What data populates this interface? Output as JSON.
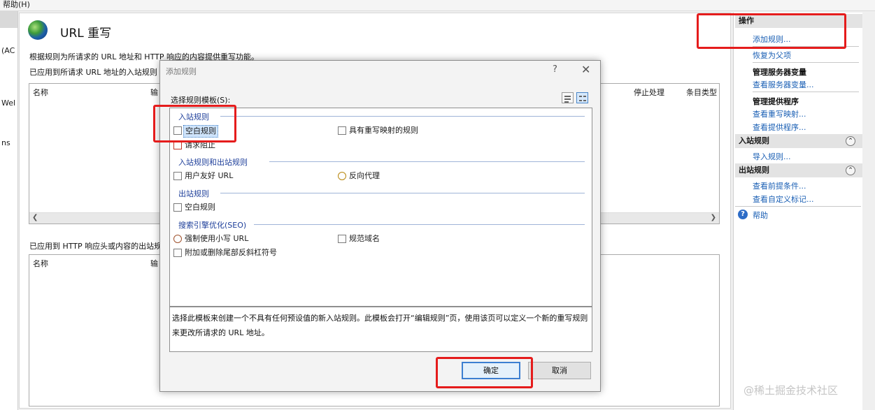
{
  "menubar": {
    "help": "帮助(H)"
  },
  "lefttree": {
    "fragments": [
      "(AC",
      "Wel",
      "ns"
    ]
  },
  "main": {
    "title": "URL 重写",
    "description": "根据规则为所请求的 URL 地址和 HTTP 响应的内容提供重写功能。",
    "inbound_label": "已应用到所请求 URL 地址的入站规则",
    "inbound_columns": [
      "名称",
      "输",
      "停止处理",
      "条目类型"
    ],
    "outbound_label": "已应用到 HTTP 响应头或内容的出站规",
    "outbound_columns": [
      "名称",
      "输"
    ]
  },
  "actions": {
    "header": "操作",
    "items": {
      "add_rules": "添加规则...",
      "revert": "恢复为父项",
      "server_vars_title": "管理服务器变量",
      "view_server_vars": "查看服务器变量...",
      "providers_title": "管理提供程序",
      "view_rewrite_maps": "查看重写映射...",
      "view_providers": "查看提供程序...",
      "inbound_section": "入站规则",
      "import_rules": "导入规则...",
      "outbound_section": "出站规则",
      "view_preconditions": "查看前提条件...",
      "view_custom_tags": "查看自定义标记...",
      "help": "帮助"
    }
  },
  "dialog": {
    "title": "添加规则",
    "help_glyph": "?",
    "close_glyph": "✕",
    "select_template_label": "选择规则模板(S):",
    "groups": {
      "inbound": "入站规则",
      "inbound_outbound": "入站规则和出站规则",
      "outbound": "出站规则",
      "seo": "搜索引擎优化(SEO)"
    },
    "templates": {
      "blank_rule": "空白规则",
      "rule_with_map": "具有重写映射的规则",
      "request_blocking": "请求阻止",
      "user_friendly_url": "用户友好 URL",
      "reverse_proxy": "反向代理",
      "outbound_blank_rule": "空白规则",
      "enforce_lowercase": "强制使用小写 URL",
      "canonical_domain": "规范域名",
      "trailing_slash": "附加或删除尾部反斜杠符号"
    },
    "description": "选择此模板来创建一个不具有任何预设值的新入站规则。此模板会打开“编辑规则”页，使用该页可以定义一个新的重写规则来更改所请求的 URL 地址。",
    "ok_label": "确定",
    "cancel_label": "取消"
  },
  "watermark": "@稀土掘金技术社区",
  "colors": {
    "highlight": "#e51c1c",
    "link": "#1a5fb4",
    "group_label": "#1e3f9a"
  }
}
